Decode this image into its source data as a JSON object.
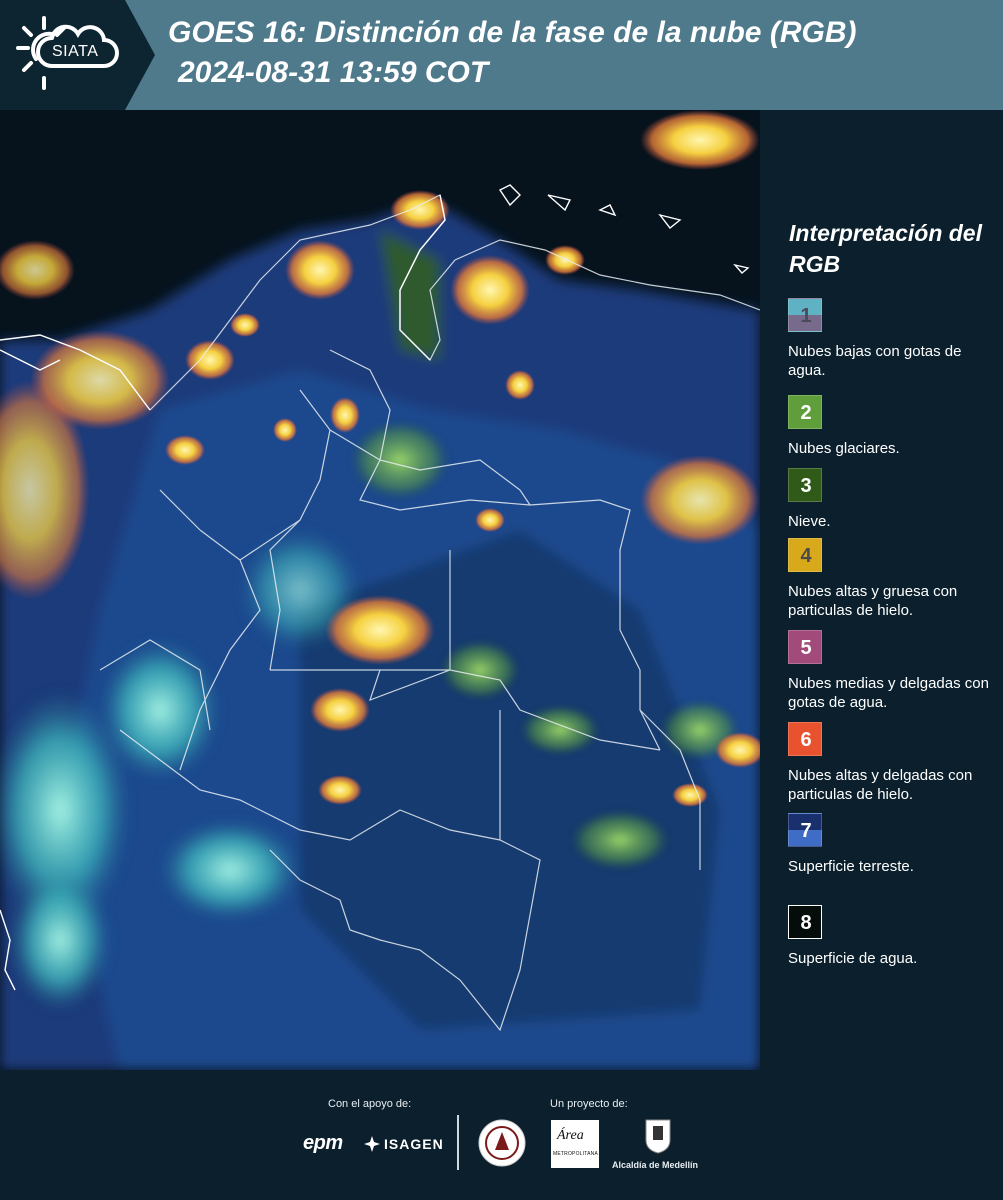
{
  "header": {
    "logo_text": "SIATA",
    "title_line1": "GOES 16: Distinción de la fase de la nube (RGB)",
    "title_line2": "2024-08-31 13:59 COT"
  },
  "legend": {
    "title": "Interpretación del RGB",
    "items": [
      {
        "number": "1",
        "description": "Nubes bajas con gotas de agua.",
        "colors": [
          "#5fb1c4",
          "#786a8a"
        ],
        "number_color": "#4a4a5a"
      },
      {
        "number": "2",
        "description": "Nubes glaciares.",
        "colors": [
          "#5f9e3a"
        ],
        "number_color": "#ffffff"
      },
      {
        "number": "3",
        "description": "Nieve.",
        "colors": [
          "#2f5a18"
        ],
        "number_color": "#ffffff"
      },
      {
        "number": "4",
        "description": "Nubes altas y gruesa con particulas de hielo.",
        "colors": [
          "#d9a91c"
        ],
        "number_color": "#4a4a4a"
      },
      {
        "number": "5",
        "description": "Nubes medias y delgadas con gotas de agua.",
        "colors": [
          "#a24b7a"
        ],
        "number_color": "#ffffff"
      },
      {
        "number": "6",
        "description": "Nubes altas y delgadas con particulas de hielo.",
        "colors": [
          "#e8522e"
        ],
        "number_color": "#ffffff"
      },
      {
        "number": "7",
        "description": "Superficie terreste.",
        "colors": [
          "#1a2f6e",
          "#3f6cc4"
        ],
        "number_color": "#ffffff"
      },
      {
        "number": "8",
        "description": "Superficie de agua.",
        "colors": [
          "#050d0b"
        ],
        "number_color": "#ffffff"
      }
    ]
  },
  "footer": {
    "support_label": "Con el apoyo de:",
    "project_label": "Un proyecto de:",
    "epm_logo": "epm",
    "isagen_logo": "ISAGEN",
    "area_logo_text": "Área",
    "area_logo_sub": "METROPOLITANA",
    "alcaldia_label": "Alcaldía de Medellín"
  },
  "map_image": {
    "description": "GOES 16 RGB satellite imagery over Colombia with department boundaries"
  }
}
